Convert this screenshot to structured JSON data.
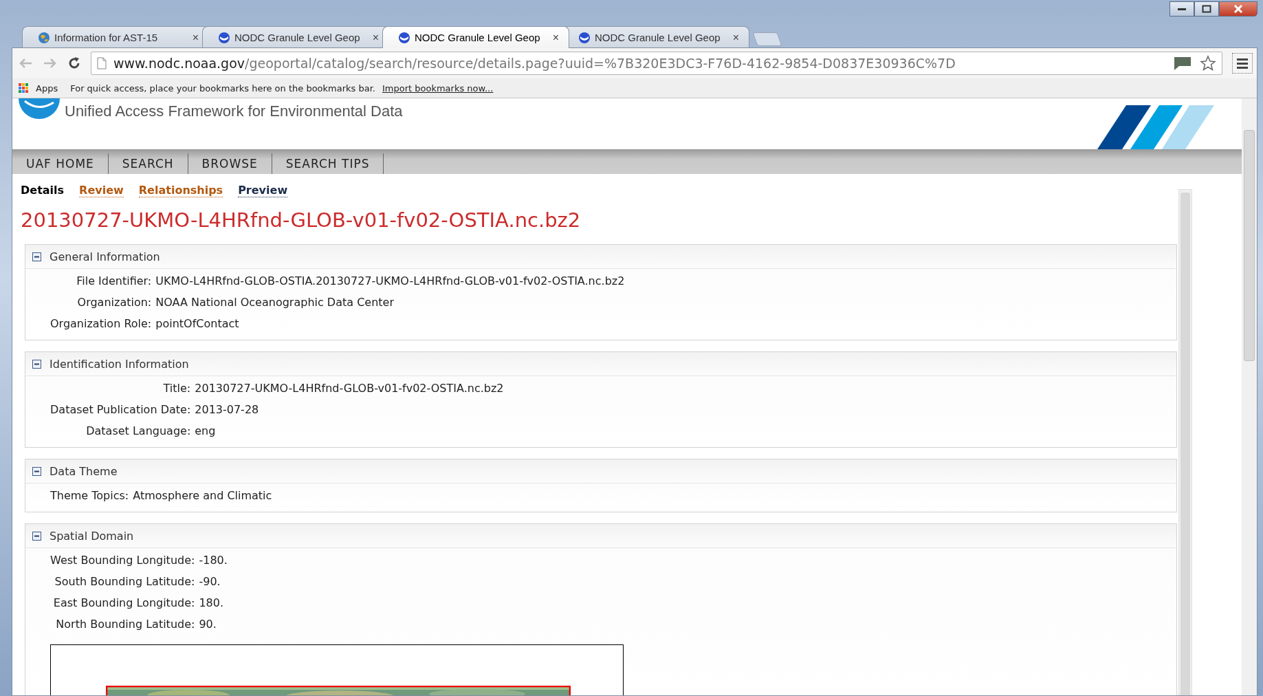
{
  "browser": {
    "tabs": [
      {
        "label": "Information for AST-15",
        "kind": "globe",
        "selected": false
      },
      {
        "label": "NODC Granule Level Geop",
        "kind": "noaa",
        "selected": false
      },
      {
        "label": "NODC Granule Level Geop",
        "kind": "noaa",
        "selected": true
      },
      {
        "label": "NODC Granule Level Geop",
        "kind": "noaa",
        "selected": false
      }
    ],
    "close_glyph": "×",
    "address": {
      "host": "www.nodc.noaa.gov",
      "path": "/geoportal/catalog/search/resource/details.page?uuid=%7B320E3DC3-F76D-4162-9854-D0837E30936C%7D"
    },
    "bookmarks_bar": {
      "apps_label": "Apps",
      "message": "For quick access, place your bookmarks here on the bookmarks bar.",
      "import_link": "Import bookmarks now..."
    }
  },
  "site": {
    "subtitle": "Unified Access Framework for Environmental Data",
    "nav": [
      "UAF HOME",
      "SEARCH",
      "BROWSE",
      "SEARCH TIPS"
    ],
    "subtabs": [
      {
        "label": "Details",
        "selected": true,
        "visited": false
      },
      {
        "label": "Review",
        "selected": false,
        "visited": false
      },
      {
        "label": "Relationships",
        "selected": false,
        "visited": false
      },
      {
        "label": "Preview",
        "selected": false,
        "visited": true
      }
    ],
    "title": "20130727-UKMO-L4HRfnd-GLOB-v01-fv02-OSTIA.nc.bz2",
    "sections": [
      {
        "heading": "General Information",
        "expanded": true,
        "fields": [
          {
            "label": "File Identifier:",
            "value": "UKMO-L4HRfnd-GLOB-OSTIA.20130727-UKMO-L4HRfnd-GLOB-v01-fv02-OSTIA.nc.bz2"
          },
          {
            "label": "Organization:",
            "value": "NOAA National Oceanographic Data Center"
          },
          {
            "label": "Organization Role:",
            "value": "pointOfContact"
          }
        ]
      },
      {
        "heading": "Identification Information",
        "expanded": true,
        "fields": [
          {
            "label": "Title:",
            "value": "20130727-UKMO-L4HRfnd-GLOB-v01-fv02-OSTIA.nc.bz2"
          },
          {
            "label": "Dataset Publication Date:",
            "value": "2013-07-28"
          },
          {
            "label": "Dataset Language:",
            "value": "eng"
          }
        ]
      },
      {
        "heading": "Data Theme",
        "expanded": true,
        "fields": [
          {
            "label": "Theme Topics:",
            "value": "Atmosphere and Climatic"
          }
        ]
      },
      {
        "heading": "Spatial Domain",
        "expanded": true,
        "fields": [
          {
            "label": "West Bounding Longitude:",
            "value": "-180."
          },
          {
            "label": "South Bounding Latitude:",
            "value": "-90."
          },
          {
            "label": "East Bounding Longitude:",
            "value": "180."
          },
          {
            "label": "North Bounding Latitude:",
            "value": "90."
          }
        ]
      }
    ]
  }
}
